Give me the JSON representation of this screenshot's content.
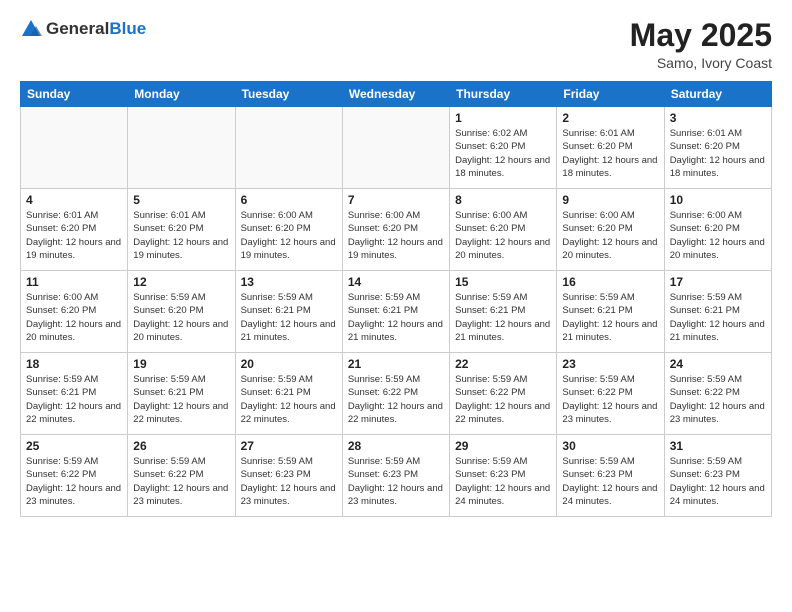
{
  "header": {
    "logo_general": "General",
    "logo_blue": "Blue",
    "title": "May 2025",
    "location": "Samo, Ivory Coast"
  },
  "weekdays": [
    "Sunday",
    "Monday",
    "Tuesday",
    "Wednesday",
    "Thursday",
    "Friday",
    "Saturday"
  ],
  "weeks": [
    [
      {
        "day": "",
        "info": ""
      },
      {
        "day": "",
        "info": ""
      },
      {
        "day": "",
        "info": ""
      },
      {
        "day": "",
        "info": ""
      },
      {
        "day": "1",
        "info": "Sunrise: 6:02 AM\nSunset: 6:20 PM\nDaylight: 12 hours\nand 18 minutes."
      },
      {
        "day": "2",
        "info": "Sunrise: 6:01 AM\nSunset: 6:20 PM\nDaylight: 12 hours\nand 18 minutes."
      },
      {
        "day": "3",
        "info": "Sunrise: 6:01 AM\nSunset: 6:20 PM\nDaylight: 12 hours\nand 18 minutes."
      }
    ],
    [
      {
        "day": "4",
        "info": "Sunrise: 6:01 AM\nSunset: 6:20 PM\nDaylight: 12 hours\nand 19 minutes."
      },
      {
        "day": "5",
        "info": "Sunrise: 6:01 AM\nSunset: 6:20 PM\nDaylight: 12 hours\nand 19 minutes."
      },
      {
        "day": "6",
        "info": "Sunrise: 6:00 AM\nSunset: 6:20 PM\nDaylight: 12 hours\nand 19 minutes."
      },
      {
        "day": "7",
        "info": "Sunrise: 6:00 AM\nSunset: 6:20 PM\nDaylight: 12 hours\nand 19 minutes."
      },
      {
        "day": "8",
        "info": "Sunrise: 6:00 AM\nSunset: 6:20 PM\nDaylight: 12 hours\nand 20 minutes."
      },
      {
        "day": "9",
        "info": "Sunrise: 6:00 AM\nSunset: 6:20 PM\nDaylight: 12 hours\nand 20 minutes."
      },
      {
        "day": "10",
        "info": "Sunrise: 6:00 AM\nSunset: 6:20 PM\nDaylight: 12 hours\nand 20 minutes."
      }
    ],
    [
      {
        "day": "11",
        "info": "Sunrise: 6:00 AM\nSunset: 6:20 PM\nDaylight: 12 hours\nand 20 minutes."
      },
      {
        "day": "12",
        "info": "Sunrise: 5:59 AM\nSunset: 6:20 PM\nDaylight: 12 hours\nand 20 minutes."
      },
      {
        "day": "13",
        "info": "Sunrise: 5:59 AM\nSunset: 6:21 PM\nDaylight: 12 hours\nand 21 minutes."
      },
      {
        "day": "14",
        "info": "Sunrise: 5:59 AM\nSunset: 6:21 PM\nDaylight: 12 hours\nand 21 minutes."
      },
      {
        "day": "15",
        "info": "Sunrise: 5:59 AM\nSunset: 6:21 PM\nDaylight: 12 hours\nand 21 minutes."
      },
      {
        "day": "16",
        "info": "Sunrise: 5:59 AM\nSunset: 6:21 PM\nDaylight: 12 hours\nand 21 minutes."
      },
      {
        "day": "17",
        "info": "Sunrise: 5:59 AM\nSunset: 6:21 PM\nDaylight: 12 hours\nand 21 minutes."
      }
    ],
    [
      {
        "day": "18",
        "info": "Sunrise: 5:59 AM\nSunset: 6:21 PM\nDaylight: 12 hours\nand 22 minutes."
      },
      {
        "day": "19",
        "info": "Sunrise: 5:59 AM\nSunset: 6:21 PM\nDaylight: 12 hours\nand 22 minutes."
      },
      {
        "day": "20",
        "info": "Sunrise: 5:59 AM\nSunset: 6:21 PM\nDaylight: 12 hours\nand 22 minutes."
      },
      {
        "day": "21",
        "info": "Sunrise: 5:59 AM\nSunset: 6:22 PM\nDaylight: 12 hours\nand 22 minutes."
      },
      {
        "day": "22",
        "info": "Sunrise: 5:59 AM\nSunset: 6:22 PM\nDaylight: 12 hours\nand 22 minutes."
      },
      {
        "day": "23",
        "info": "Sunrise: 5:59 AM\nSunset: 6:22 PM\nDaylight: 12 hours\nand 23 minutes."
      },
      {
        "day": "24",
        "info": "Sunrise: 5:59 AM\nSunset: 6:22 PM\nDaylight: 12 hours\nand 23 minutes."
      }
    ],
    [
      {
        "day": "25",
        "info": "Sunrise: 5:59 AM\nSunset: 6:22 PM\nDaylight: 12 hours\nand 23 minutes."
      },
      {
        "day": "26",
        "info": "Sunrise: 5:59 AM\nSunset: 6:22 PM\nDaylight: 12 hours\nand 23 minutes."
      },
      {
        "day": "27",
        "info": "Sunrise: 5:59 AM\nSunset: 6:23 PM\nDaylight: 12 hours\nand 23 minutes."
      },
      {
        "day": "28",
        "info": "Sunrise: 5:59 AM\nSunset: 6:23 PM\nDaylight: 12 hours\nand 23 minutes."
      },
      {
        "day": "29",
        "info": "Sunrise: 5:59 AM\nSunset: 6:23 PM\nDaylight: 12 hours\nand 24 minutes."
      },
      {
        "day": "30",
        "info": "Sunrise: 5:59 AM\nSunset: 6:23 PM\nDaylight: 12 hours\nand 24 minutes."
      },
      {
        "day": "31",
        "info": "Sunrise: 5:59 AM\nSunset: 6:23 PM\nDaylight: 12 hours\nand 24 minutes."
      }
    ]
  ]
}
